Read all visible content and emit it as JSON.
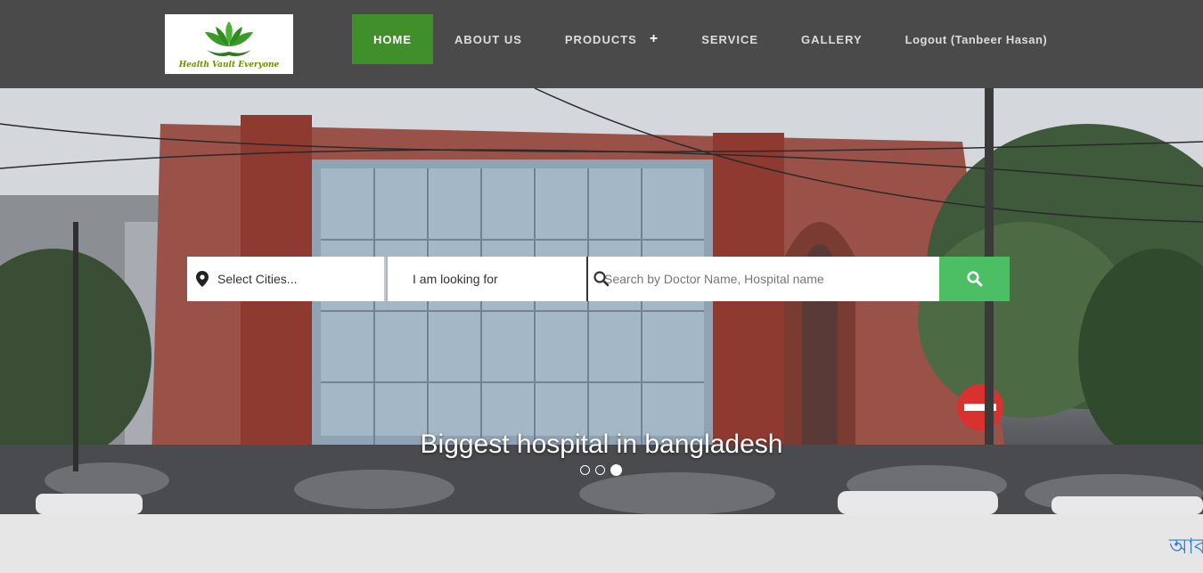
{
  "brand": {
    "logo_text": "Health Vault Everyone"
  },
  "nav": {
    "items": [
      {
        "label": "HOME"
      },
      {
        "label": "ABOUT US"
      },
      {
        "label": "PRODUCTS"
      },
      {
        "label": "SERVICE"
      },
      {
        "label": "GALLERY"
      },
      {
        "label": "Logout (Tanbeer Hasan)"
      }
    ],
    "products_expand_icon": "plus-icon"
  },
  "search": {
    "city_label": "Select Cities...",
    "looking_label": "I am looking for",
    "query_placeholder": "Search by Doctor Name, Hospital name",
    "city_icon": "map-marker-icon",
    "button_icon": "search-icon"
  },
  "slider": {
    "caption": "Biggest hospital in bangladesh",
    "slide_count": 3,
    "active_slide": 3
  },
  "marquee": {
    "text": "আব"
  },
  "colors": {
    "header_bg": "#4a4a4a",
    "nav_active": "#3f8f2a",
    "search_button": "#4cbf65",
    "marquee_text": "#2a7fd4"
  }
}
